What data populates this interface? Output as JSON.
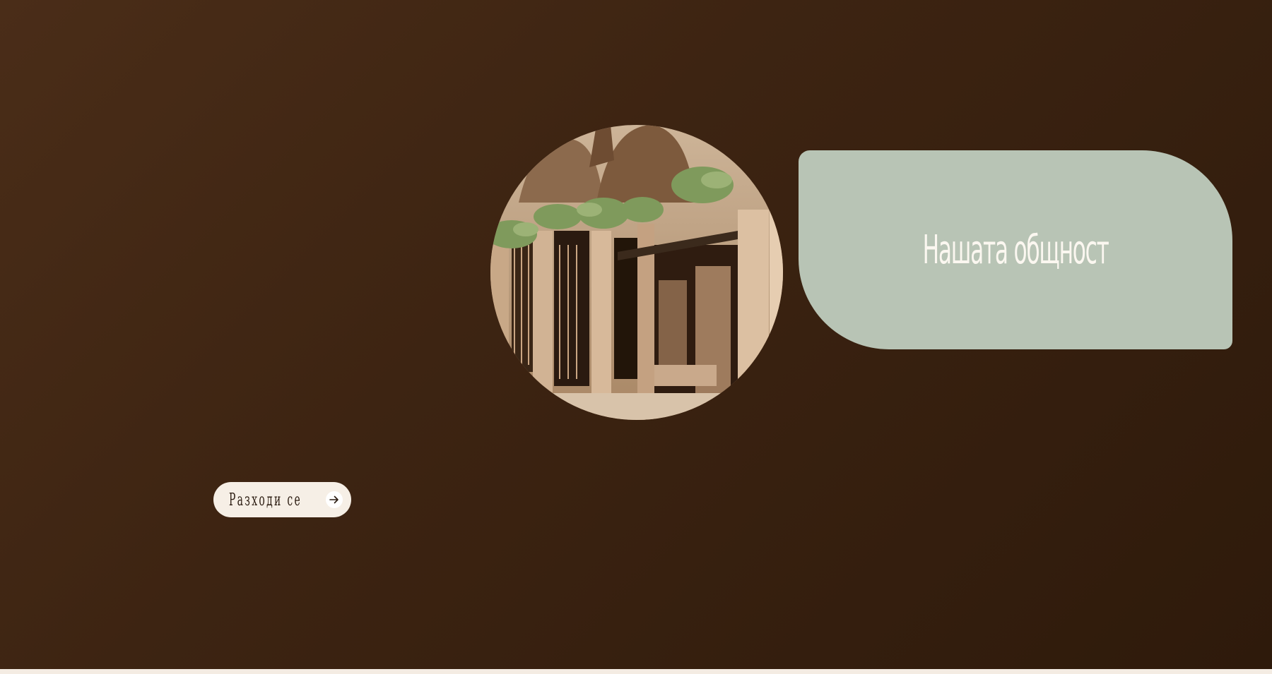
{
  "hero": {
    "background_colors": [
      "#4a2d18",
      "#2e1a0b"
    ]
  },
  "photo": {
    "icon": "arcade-street-photo"
  },
  "title_card": {
    "title": "Нашата общност",
    "color": "#b8c4b5"
  },
  "walk_button": {
    "label": "Разходи се",
    "icon": "arrow-right-icon"
  }
}
